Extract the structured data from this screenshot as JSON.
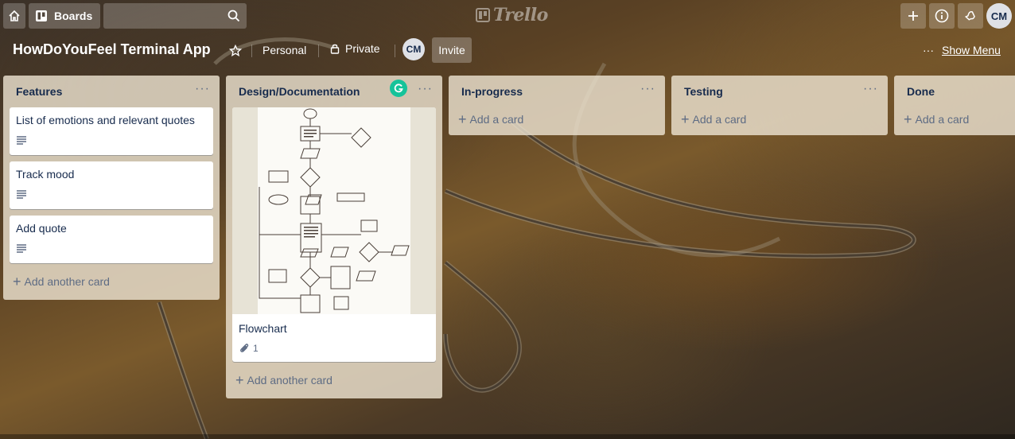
{
  "header": {
    "boards_label": "Boards",
    "search_placeholder": "",
    "logo_text": "Trello",
    "avatar_initials": "CM"
  },
  "board": {
    "title": "HowDoYouFeel Terminal App",
    "visibility_team": "Personal",
    "visibility_privacy": "Private",
    "member_initials": "CM",
    "invite_label": "Invite",
    "menu_label": "Show Menu",
    "menu_dots": "···"
  },
  "lists": [
    {
      "title": "Features",
      "cards": [
        {
          "title": "List of emotions and relevant quotes",
          "has_description": true
        },
        {
          "title": "Track mood",
          "has_description": true
        },
        {
          "title": "Add quote",
          "has_description": true
        }
      ],
      "add_label": "Add another card"
    },
    {
      "title": "Design/Documentation",
      "cards": [
        {
          "title": "Flowchart",
          "attachments": "1",
          "has_cover": true
        }
      ],
      "add_label": "Add another card"
    },
    {
      "title": "In-progress",
      "cards": [],
      "add_label": "Add a card"
    },
    {
      "title": "Testing",
      "cards": [],
      "add_label": "Add a card"
    },
    {
      "title": "Done",
      "cards": [],
      "add_label": "Add a card"
    }
  ],
  "list_menu": "···",
  "colors": {
    "list_bg": "#ebe2d0",
    "grammarly": "#15c39a"
  }
}
